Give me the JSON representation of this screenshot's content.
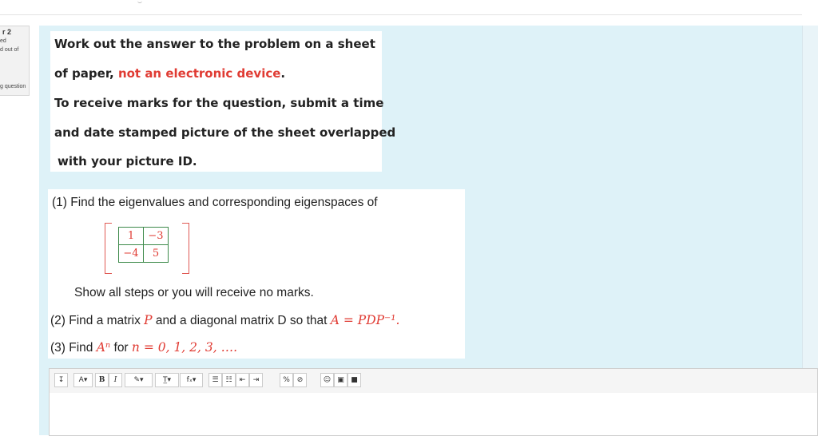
{
  "question_info": {
    "number_fragment": "r 2",
    "state_fragment": "ed",
    "mark_fragment": "d out of",
    "flag_fragment": "g question"
  },
  "instructions": {
    "line1": "Work out the answer to the problem on a sheet",
    "line2_prefix": "of paper, ",
    "line2_highlight": "not an electronic device",
    "line2_suffix": ".",
    "line3": "To receive marks for the question, submit a time",
    "line4": "and date stamped picture of the sheet overlapped",
    "line5": "with your picture  ID."
  },
  "problem": {
    "part1": "(1)  Find the eigenvalues and corresponding eigenspaces of",
    "matrix": [
      [
        "1",
        "−3"
      ],
      [
        "−4",
        "5"
      ]
    ],
    "steps_note": "Show all steps or you will receive no marks.",
    "part2_prefix": "(2) Find a matrix ",
    "part2_var": "P",
    "part2_mid": " and a diagonal matrix D so that ",
    "part2_eq": "A = PDP⁻¹.",
    "part3_prefix": "(3) Find ",
    "part3_var": "Aⁿ",
    "part3_mid": "  for ",
    "part3_eq": "n = 0, 1, 2, 3, …."
  },
  "toolbar": {
    "expand": "↧",
    "font_size": "A▾",
    "bold": "B",
    "italic": "I",
    "style": "✎▾",
    "text_color": "T̲▾",
    "formula": "fₓ▾",
    "unordered_list": "☰",
    "ordered_list": "☷",
    "outdent": "⇤",
    "indent": "⇥",
    "link": "%",
    "unlink": "⊘",
    "emoji": "☺",
    "image": "▣",
    "media": "■"
  },
  "colors": {
    "accent_red": "#e03b33",
    "formulation_bg": "#def2f8",
    "matrix_border": "#3d8a4a"
  },
  "editor": {
    "value": ""
  }
}
